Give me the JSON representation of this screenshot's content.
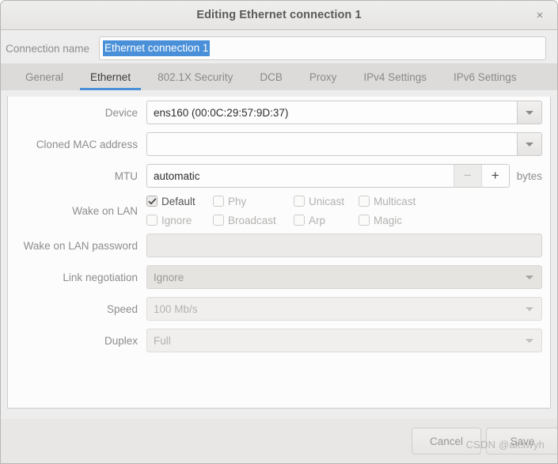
{
  "window": {
    "title": "Editing Ethernet connection 1",
    "close_icon": "close-icon",
    "close_glyph": "×"
  },
  "connection": {
    "label": "Connection name",
    "value": "Ethernet connection 1",
    "selected": true,
    "selection_color": "#4a90d9"
  },
  "tabs": {
    "active_index": 1,
    "accent_color": "#4a90d9",
    "items": [
      {
        "label": "General"
      },
      {
        "label": "Ethernet"
      },
      {
        "label": "802.1X Security"
      },
      {
        "label": "DCB"
      },
      {
        "label": "Proxy"
      },
      {
        "label": "IPv4 Settings"
      },
      {
        "label": "IPv6 Settings"
      }
    ]
  },
  "form": {
    "device": {
      "label": "Device",
      "value": "ens160 (00:0C:29:57:9D:37)",
      "enabled": true
    },
    "cloned_mac": {
      "label": "Cloned MAC address",
      "value": "",
      "enabled": true
    },
    "mtu": {
      "label": "MTU",
      "value": "automatic",
      "unit": "bytes",
      "minus_label": "−",
      "plus_label": "+",
      "minus_enabled": false,
      "plus_enabled": true
    },
    "wake_on_lan": {
      "label": "Wake on LAN",
      "options": [
        {
          "label": "Default",
          "checked": true,
          "enabled": true
        },
        {
          "label": "Phy",
          "checked": false,
          "enabled": false
        },
        {
          "label": "Unicast",
          "checked": false,
          "enabled": false
        },
        {
          "label": "Multicast",
          "checked": false,
          "enabled": false
        },
        {
          "label": "Ignore",
          "checked": false,
          "enabled": false
        },
        {
          "label": "Broadcast",
          "checked": false,
          "enabled": false
        },
        {
          "label": "Arp",
          "checked": false,
          "enabled": false
        },
        {
          "label": "Magic",
          "checked": false,
          "enabled": false
        }
      ]
    },
    "wol_password": {
      "label": "Wake on LAN password",
      "value": "",
      "enabled": false
    },
    "link_negotiation": {
      "label": "Link negotiation",
      "value": "Ignore",
      "enabled": false
    },
    "speed": {
      "label": "Speed",
      "value": "100 Mb/s",
      "enabled": false
    },
    "duplex": {
      "label": "Duplex",
      "value": "Full",
      "enabled": false
    }
  },
  "footer": {
    "cancel_label": "Cancel",
    "save_label": "Save"
  },
  "watermark": {
    "text": "CSDN @akswyh"
  }
}
